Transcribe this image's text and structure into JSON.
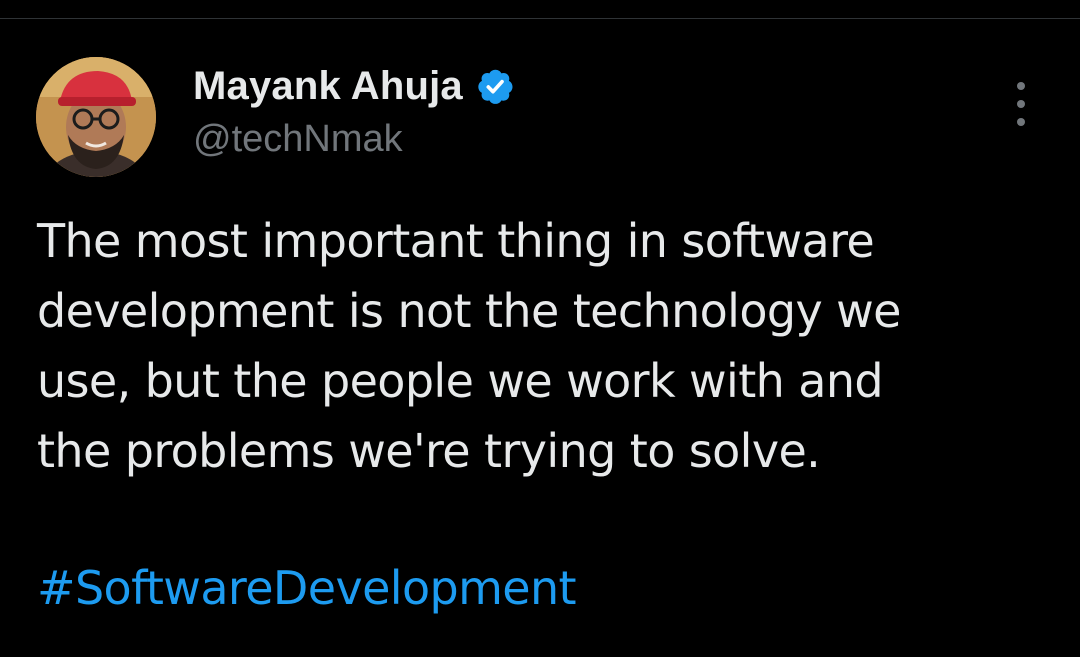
{
  "tweet": {
    "author": {
      "display_name": "Mayank Ahuja",
      "handle": "@techNmak",
      "verified": true,
      "verified_color": "#1d9bf0"
    },
    "text_lines": [
      "The most important thing in software",
      "development is not the technology we",
      "use, but the people we work with and",
      "the problems we're trying to solve."
    ],
    "hashtag": "#SoftwareDevelopment",
    "menu_icon": "more-vertical-icon"
  },
  "theme": {
    "background": "#000000",
    "text": "#e7e9ea",
    "secondary_text": "#71767b",
    "link": "#1d9bf0"
  }
}
